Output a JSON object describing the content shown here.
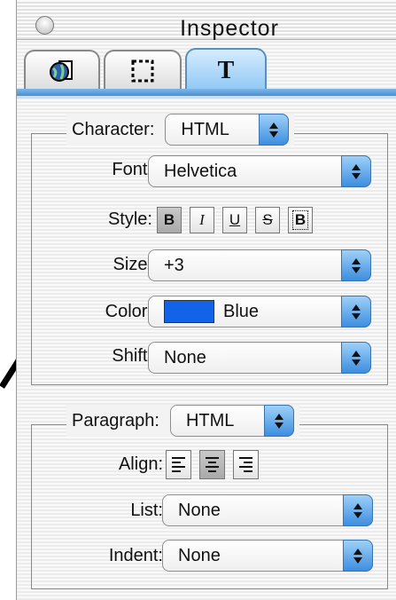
{
  "window": {
    "title": "Inspector"
  },
  "tabs": [
    {
      "icon": "globe-document-icon"
    },
    {
      "icon": "selection-frame-icon"
    },
    {
      "label": "T",
      "icon": "text-icon",
      "active": true
    }
  ],
  "character": {
    "label": "Character:",
    "mode": "HTML",
    "font": {
      "label": "Font:",
      "value": "Helvetica"
    },
    "style": {
      "label": "Style:",
      "buttons": [
        "B",
        "I",
        "U",
        "S",
        "B"
      ],
      "active": [
        "B"
      ]
    },
    "size": {
      "label": "Size:",
      "value": "+3"
    },
    "color": {
      "label": "Color:",
      "value": "Blue",
      "swatch": "#1263e8"
    },
    "shift": {
      "label": "Shift:",
      "value": "None"
    }
  },
  "paragraph": {
    "label": "Paragraph:",
    "mode": "HTML",
    "align": {
      "label": "Align:",
      "options": [
        "left",
        "center",
        "right"
      ],
      "selected": "center"
    },
    "list": {
      "label": "List:",
      "value": "None"
    },
    "indent": {
      "label": "Indent:",
      "value": "None"
    }
  },
  "colors": {
    "accent": "#4a8fd0",
    "arrow": "#000000"
  }
}
